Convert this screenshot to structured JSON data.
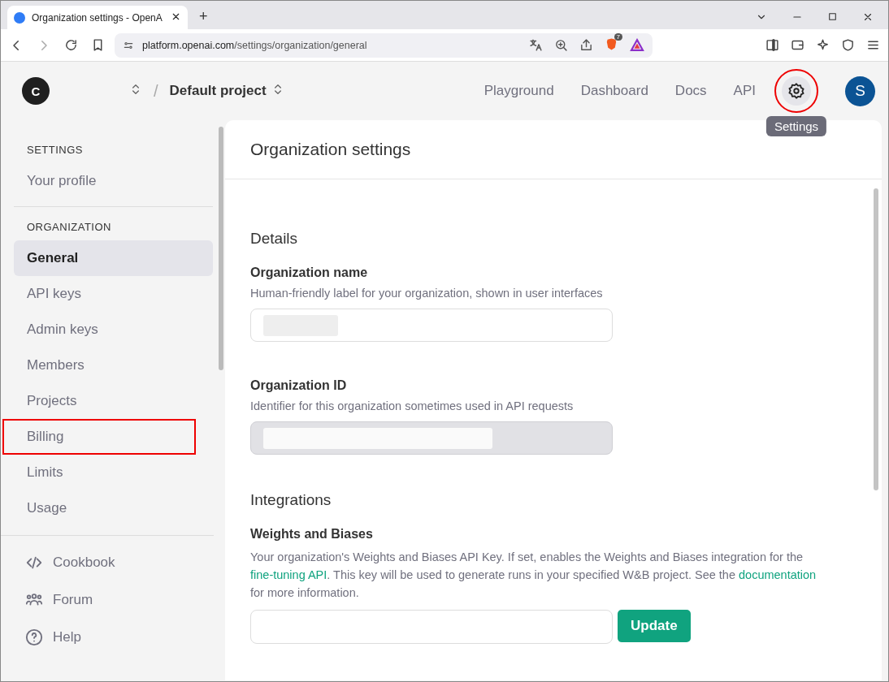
{
  "browser": {
    "tab_title": "Organization settings - OpenA",
    "new_tab": "+",
    "url_host": "platform.openai.com",
    "url_path": "/settings/organization/general",
    "shield_badge": "7"
  },
  "header": {
    "org_avatar": "C",
    "separator": "/",
    "project": "Default project",
    "nav": [
      "Playground",
      "Dashboard",
      "Docs",
      "API"
    ],
    "settings_highlighted": true,
    "settings_tooltip": "Settings",
    "user_avatar": "S"
  },
  "sidebar": {
    "sections": [
      {
        "heading": "SETTINGS",
        "items": [
          {
            "label": "Your profile",
            "selected": false,
            "highlighted": false
          }
        ]
      },
      {
        "heading": "ORGANIZATION",
        "items": [
          {
            "label": "General",
            "selected": true,
            "highlighted": false
          },
          {
            "label": "API keys",
            "selected": false,
            "highlighted": false
          },
          {
            "label": "Admin keys",
            "selected": false,
            "highlighted": false
          },
          {
            "label": "Members",
            "selected": false,
            "highlighted": false
          },
          {
            "label": "Projects",
            "selected": false,
            "highlighted": false
          },
          {
            "label": "Billing",
            "selected": false,
            "highlighted": true
          },
          {
            "label": "Limits",
            "selected": false,
            "highlighted": false
          },
          {
            "label": "Usage",
            "selected": false,
            "highlighted": false
          }
        ]
      }
    ],
    "footer": [
      {
        "kind": "code",
        "label": "Cookbook"
      },
      {
        "kind": "people",
        "label": "Forum"
      },
      {
        "kind": "help",
        "label": "Help"
      }
    ]
  },
  "main": {
    "title": "Organization settings",
    "sections": [
      {
        "heading": "Details",
        "fields": [
          {
            "label": "Organization name",
            "hint": "Human-friendly label for your organization, shown in user interfaces",
            "disabled": false
          },
          {
            "label": "Organization ID",
            "hint": "Identifier for this organization sometimes used in API requests",
            "disabled": true
          }
        ]
      },
      {
        "heading": "Integrations",
        "integration": {
          "label": "Weights and Biases",
          "description": "Your organization's Weights and Biases API Key. If set, enables the Weights and Biases integration for the ",
          "link1": "fine-tuning API",
          "middle": ". This key will be used to generate runs in your specified W&B project. See the ",
          "link2": "documentation",
          "end": " for more information.",
          "button": "Update"
        }
      }
    ]
  }
}
